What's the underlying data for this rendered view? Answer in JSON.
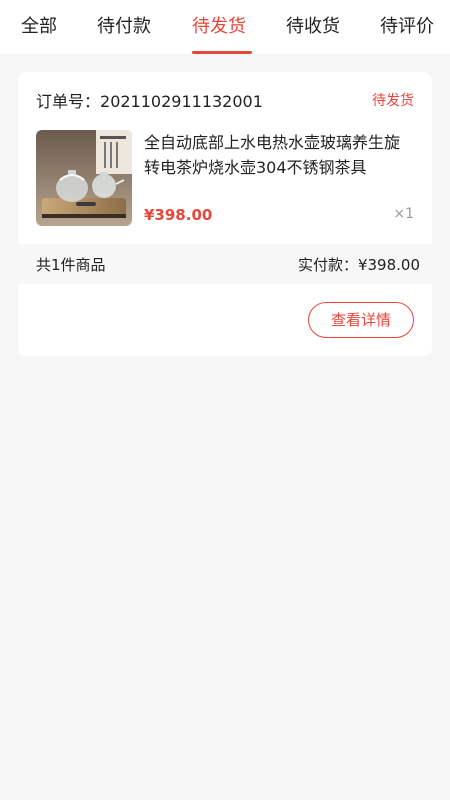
{
  "tabs": [
    {
      "label": "全部",
      "active": false
    },
    {
      "label": "待付款",
      "active": false
    },
    {
      "label": "待发货",
      "active": true
    },
    {
      "label": "待收货",
      "active": false
    },
    {
      "label": "待评价",
      "active": false
    }
  ],
  "colors": {
    "accent": "#e8463a"
  },
  "order": {
    "number_label": "订单号：",
    "number": "2021102911132001",
    "status": "待发货",
    "product": {
      "title": "全自动底部上水电热水壶玻璃养生旋转电茶炉烧水壶304不锈钢茶具",
      "price": "¥398.00",
      "quantity": "×1",
      "image_icon": "kettle-product-image"
    },
    "summary": {
      "count_text": "共1件商品",
      "paid_label": "实付款：",
      "paid_amount": "¥398.00"
    },
    "detail_button_label": "查看详情"
  }
}
